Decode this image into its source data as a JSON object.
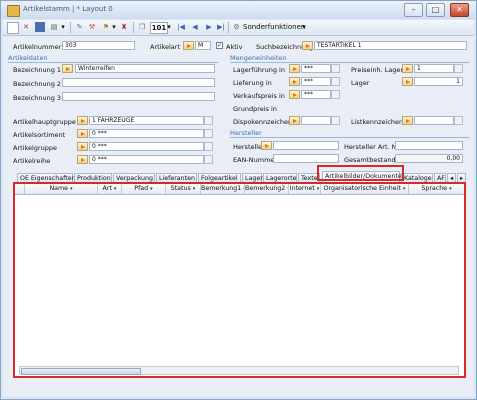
{
  "window": {
    "title": "Artikelstamm | * Layout 0"
  },
  "toolbar": {
    "counter": "101",
    "special_functions": "Sonderfunktionen"
  },
  "header": {
    "artikelnummer_label": "Artikelnummer",
    "artikelnummer_value": "303",
    "artikelart_label": "Artikelart",
    "artikelart_value": "M",
    "aktiv_label": "Aktiv",
    "suchbezeichnung_label": "Suchbezeichnung",
    "suchbezeichnung_value": "TESTARTIKEL 1"
  },
  "artikeldaten": {
    "section": "Artikeldaten",
    "bez1_label": "Bezeichnung 1",
    "bez1_value": "Winterreifen",
    "bez2_label": "Bezeichnung 2",
    "bez3_label": "Bezeichnung 3",
    "hauptgruppe_label": "Artikelhauptgruppe",
    "hauptgruppe_value": "1 FAHRZEUGE",
    "sortiment_label": "Artikelsortiment",
    "sortiment_value": "0 ***",
    "gruppe_label": "Artikelgruppe",
    "gruppe_value": "0 ***",
    "reihe_label": "Artikelreihe",
    "reihe_value": "0 ***"
  },
  "mengeneinheiten": {
    "section": "Mengeneinheiten",
    "lagerfuehrung_label": "Lagerführung in",
    "lagerfuehrung_value": "***",
    "lieferung_label": "Lieferung in",
    "lieferung_value": "***",
    "verkaufspreis_label": "Verkaufspreis in",
    "verkaufspreis_value": "***",
    "grundpreis_label": "Grundpreis in",
    "dispokennzeichen_label": "Dispokennzeichen",
    "preiseinh_label": "Preiseinh. Lager",
    "preiseinh_value": "1",
    "lager_label": "Lager",
    "lager_value": "1",
    "listkennzeichen_label": "Listkennzeichen"
  },
  "hersteller": {
    "section": "Hersteller",
    "hersteller_label": "Hersteller",
    "herstellerartnr_label": "Hersteller Art. Nr.",
    "ean_label": "EAN-Nummer",
    "gesamtbestand_label": "Gesamtbestand",
    "gesamtbestand_value": "0,00"
  },
  "tabs": [
    "OE Eigenschaften",
    "Produktion",
    "Verpackung",
    "Lieferanten",
    "Folgeartikel",
    "Lager",
    "Lagerorte",
    "Texte",
    "Artikelbilder/Dokumente",
    "Kataloge",
    "AF"
  ],
  "grid": {
    "columns": [
      "Name",
      "Art",
      "Pfad",
      "Status",
      "Bemerkung1",
      "Bemerkung2",
      "Internet",
      "Organisatorische Einheit",
      "Sprache"
    ]
  },
  "colors": {
    "accent": "#3a6db5",
    "highlight": "#d42a2a",
    "lookup": "#f2d389"
  }
}
